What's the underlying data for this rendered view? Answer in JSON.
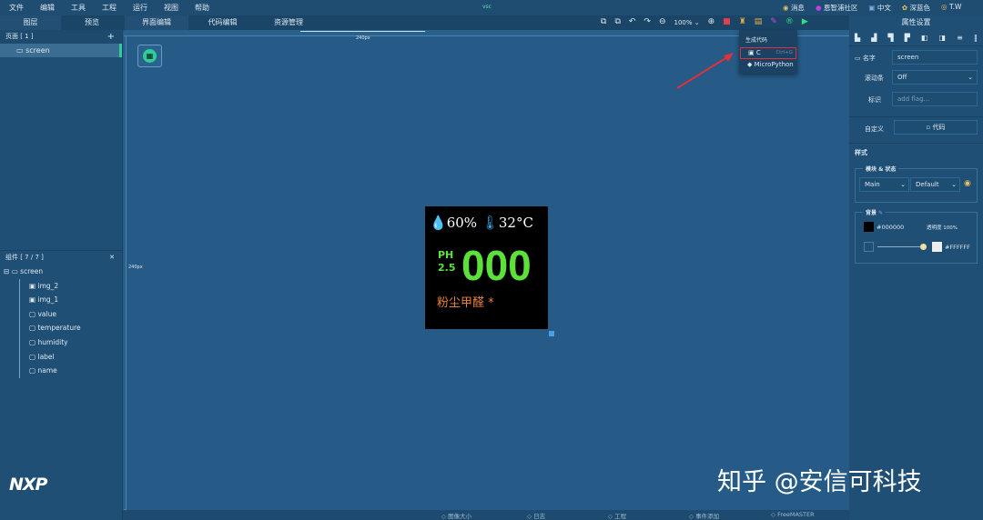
{
  "menu": [
    "文件",
    "编辑",
    "工具",
    "工程",
    "运行",
    "视图",
    "帮助"
  ],
  "title_badge": "vsc",
  "top_right": {
    "messages": "消息",
    "community": "恩智浦社区",
    "language": "中文",
    "theme": "深蓝色",
    "user": "T.W"
  },
  "left_tabs": [
    "图层",
    "预览"
  ],
  "center_tabs": [
    "界面编辑",
    "代码编辑",
    "资源管理"
  ],
  "pages": {
    "header": "页面 [ 1 ]",
    "add": "+",
    "items": [
      "screen"
    ]
  },
  "widgets": {
    "header": "组件 [ 7 / 7 ]",
    "root": "screen",
    "items": [
      {
        "icon": "image-icon",
        "label": "img_2"
      },
      {
        "icon": "image-icon",
        "label": "img_1"
      },
      {
        "icon": "text-icon",
        "label": "value"
      },
      {
        "icon": "text-icon",
        "label": "temperature"
      },
      {
        "icon": "text-icon",
        "label": "humidity"
      },
      {
        "icon": "text-icon",
        "label": "label"
      },
      {
        "icon": "text-icon",
        "label": "name"
      }
    ]
  },
  "toolbar": {
    "zoom": "100%"
  },
  "ruler": {
    "h_label": "240px",
    "v_label": "240px"
  },
  "gen_menu": {
    "title": "生成代码",
    "items": [
      {
        "label": "C",
        "shortcut": "Ctrl+G"
      },
      {
        "label": "MicroPython",
        "shortcut": ""
      }
    ]
  },
  "device": {
    "humidity": "60%",
    "temperature": "32°C",
    "ph_top": "PH",
    "ph_bottom": "2.5",
    "value": "000",
    "label": "粉尘甲醛 *"
  },
  "properties": {
    "title": "属性设置",
    "name_label": "名字",
    "name_value": "screen",
    "scroll_label": "滚动条",
    "scroll_value": "Off",
    "flag_label": "标识",
    "flag_placeholder": "add flag...",
    "custom_label": "自定义",
    "code_button": "代码",
    "style_header": "样式",
    "part_state_legend": "模块 & 状态",
    "part": "Main",
    "state": "Default",
    "bg_legend": "背景",
    "bg_color": "#000000",
    "opacity_label": "透明度",
    "opacity": "100%",
    "grad_color": "#FFFFFF"
  },
  "bottom_tabs": [
    "图像大小",
    "日志",
    "工程",
    "事件添加",
    "FreeMASTER"
  ],
  "logo": "NXP",
  "watermark": "知乎 @安信可科技",
  "colors": {
    "accent": "#2ecc9a",
    "value_green": "#5ce13a",
    "label_orange": "#e8803a"
  }
}
